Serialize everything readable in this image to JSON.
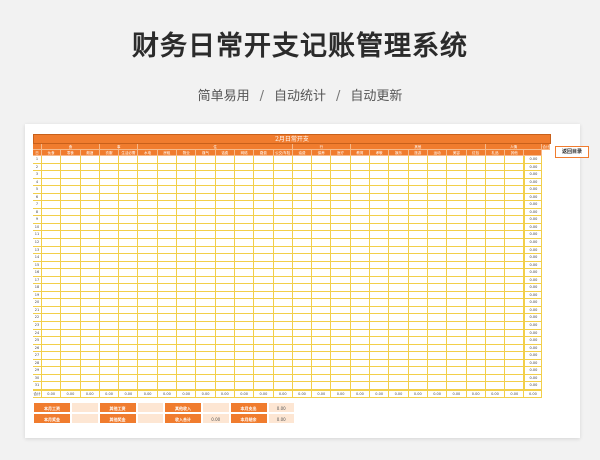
{
  "hero": {
    "title": "财务日常开支记账管理系统",
    "tagline": [
      "简单易用",
      "自动统计",
      "自动更新"
    ],
    "separator": "/"
  },
  "sheet": {
    "title": "2月日常开支",
    "back_button": "返回目录",
    "groups": [
      {
        "label": "",
        "span": 1
      },
      {
        "label": "食",
        "span": 3
      },
      {
        "label": "事",
        "span": 2
      },
      {
        "label": "住",
        "span": 8
      },
      {
        "label": "行",
        "span": 3
      },
      {
        "label": "其他",
        "span": 7
      },
      {
        "label": "人情",
        "span": 3
      },
      {
        "label": "合计",
        "span": 1
      }
    ],
    "sub_headers": [
      "日",
      "伙食",
      "零食",
      "烟酒",
      "衣服",
      "生活必需",
      "水电",
      "房租",
      "物业",
      "煤气",
      "话费",
      "网络",
      "路费",
      "公交/车险",
      "油费",
      "保养",
      "医疗",
      "教育",
      "孝敬",
      "娱乐",
      "旅游",
      "运动",
      "美容",
      "红包",
      "礼品",
      "其他",
      ""
    ],
    "row_count": 31,
    "row_total": "0.00",
    "sum_row_label": "合计",
    "sum_cell": "0.00",
    "footer": [
      {
        "label": "本月工资",
        "value": ""
      },
      {
        "label": "其他工资",
        "value": ""
      },
      {
        "label": "其他收入",
        "value": ""
      },
      {
        "label": "本月支出",
        "value": "0.00"
      },
      {
        "label": "本月奖金",
        "value": ""
      },
      {
        "label": "其他奖金",
        "value": ""
      },
      {
        "label": "收入合计",
        "value": "0.00"
      },
      {
        "label": "本月结余",
        "value": "0.00"
      }
    ]
  },
  "colors": {
    "header": "#f07c2e",
    "grid": "#f2cf4a",
    "footer_value": "#fde6d3"
  }
}
